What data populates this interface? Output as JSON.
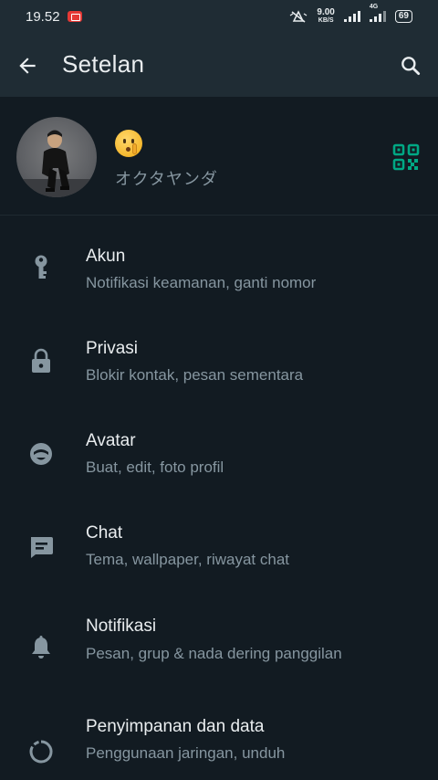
{
  "status_bar": {
    "time": "19.52",
    "net_speed_value": "9.00",
    "net_speed_unit": "KB/S",
    "network_type": "4G",
    "battery_level": "69",
    "colors": {
      "recording": "#e53935"
    }
  },
  "app_bar": {
    "title": "Setelan",
    "back_icon": "arrow-left-icon",
    "search_icon": "search-icon"
  },
  "profile": {
    "status_emoji": "shushing-face-emoji",
    "name": "オクタヤンダ",
    "qr_icon": "qr-code-icon"
  },
  "settings": [
    {
      "icon": "key-icon",
      "title": "Akun",
      "subtitle": "Notifikasi keamanan, ganti nomor"
    },
    {
      "icon": "lock-icon",
      "title": "Privasi",
      "subtitle": "Blokir kontak, pesan sementara"
    },
    {
      "icon": "avatar-face-icon",
      "title": "Avatar",
      "subtitle": "Buat, edit, foto profil"
    },
    {
      "icon": "chat-icon",
      "title": "Chat",
      "subtitle": "Tema, wallpaper, riwayat chat"
    },
    {
      "icon": "bell-icon",
      "title": "Notifikasi",
      "subtitle": "Pesan, grup & nada dering panggilan"
    },
    {
      "icon": "storage-circle-icon",
      "title": "Penyimpanan dan data",
      "subtitle": "Penggunaan jaringan, unduh"
    }
  ],
  "colors": {
    "background": "#121b22",
    "app_bar": "#1f2c34",
    "primary_text": "#e9edef",
    "secondary_text": "#8696a0",
    "accent": "#00a884"
  }
}
